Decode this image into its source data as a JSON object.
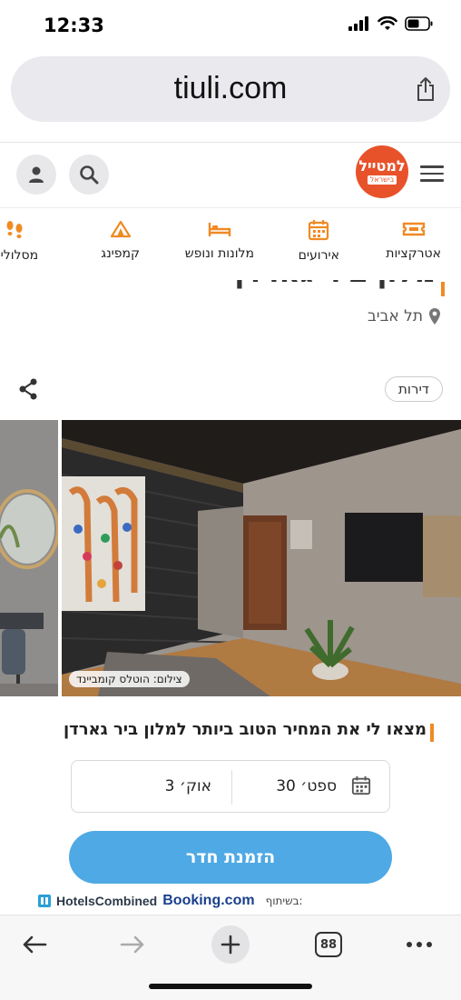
{
  "status": {
    "time": "12:33"
  },
  "browser": {
    "url": "tiuli.com",
    "tabs_count": "88"
  },
  "site": {
    "logo_main": "למטייל",
    "logo_sub": "בישראל",
    "categories": [
      {
        "label": "אטרקציות",
        "icon": "ticket-icon"
      },
      {
        "label": "אירועים",
        "icon": "calendar-icon"
      },
      {
        "label": "מלונות ונופש",
        "icon": "bed-icon"
      },
      {
        "label": "קמפינג",
        "icon": "tent-icon"
      },
      {
        "label": "מסלולים וט",
        "icon": "footsteps-icon"
      }
    ],
    "colors": {
      "brand": "#e8522b",
      "accent": "#f08a24",
      "cta": "#4fa9e4",
      "icon": "#f08a24"
    }
  },
  "listing": {
    "title": "מלון ביר גארדן",
    "location": "תל אביב",
    "tag": "דירות",
    "photo_credit": "צילום: הוטלס קומביינד"
  },
  "booking": {
    "heading": "מצאו לי את המחיר הטוב ביותר למלון ביר גארדן",
    "check_in": "30 ספט׳",
    "check_out": "3 אוק׳",
    "button": "הזמנת חדר",
    "partners_label": "בשיתוף:",
    "partner_1": "HotelsCombined",
    "partner_2": "Booking.com"
  }
}
